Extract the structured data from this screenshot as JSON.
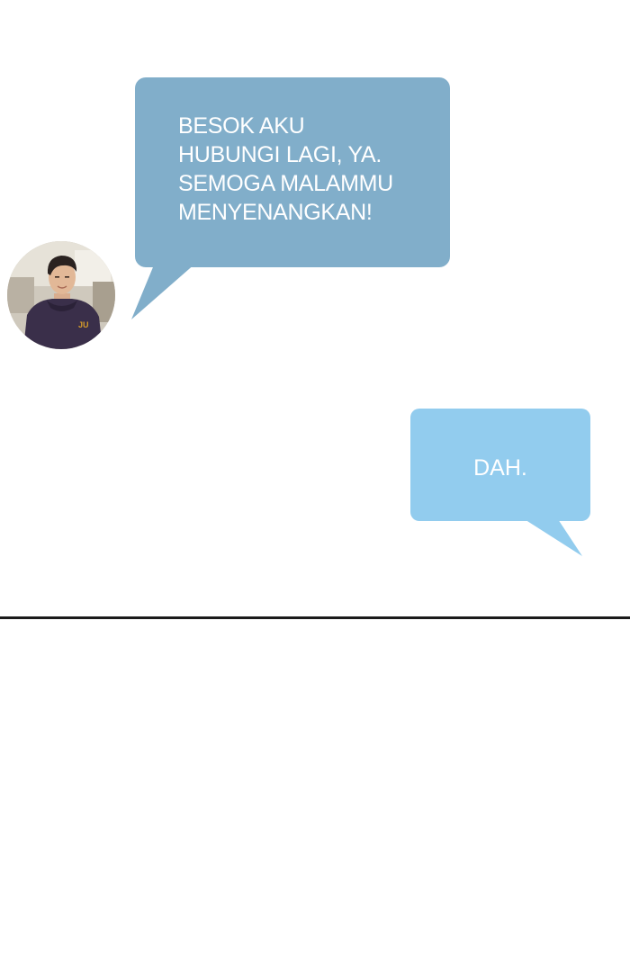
{
  "conversation": {
    "incoming_message": {
      "text": "BESOK AKU\nHUBUNGI LAGI, YA.\nSEMOGA MALAMMU\nMENYENANGKAN!"
    },
    "outgoing_message": {
      "text": "DAH."
    }
  },
  "avatar": {
    "icon": "user-portrait-icon",
    "hoodie_emblem": "JU"
  },
  "colors": {
    "incoming_bubble": "#81aeca",
    "outgoing_bubble": "#92ccee",
    "background": "#ffffff",
    "divider": "#1a1a1a"
  }
}
